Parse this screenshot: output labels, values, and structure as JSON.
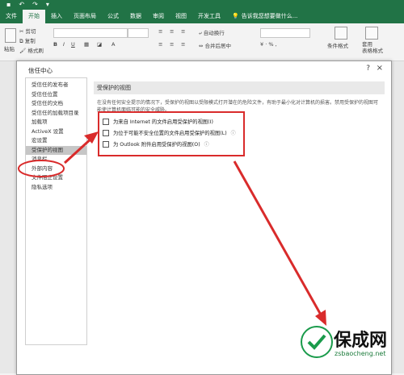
{
  "ribbon_tabs": [
    "文件",
    "开始",
    "插入",
    "页面布局",
    "公式",
    "数据",
    "审阅",
    "视图",
    "开发工具"
  ],
  "active_tab_index": 1,
  "tell_me": "告诉我您想要做什么...",
  "ribbon": {
    "paste": "粘贴",
    "cut": "剪切",
    "copy": "复制",
    "format_painter": "格式刷",
    "wrap_text": "自动换行",
    "merge_center": "合并后居中",
    "conditional_format": "条件格式",
    "table_style": "套用\n表格格式"
  },
  "dialog": {
    "title": "信任中心",
    "help": "?",
    "close": "×",
    "nav_items": [
      "受信任的发布者",
      "受信任位置",
      "受信任的文档",
      "受信任的加载项目录",
      "加载项",
      "ActiveX 设置",
      "宏设置",
      "受保护的视图",
      "消息栏",
      "外部内容",
      "文件阻止设置",
      "隐私选项"
    ],
    "active_nav_index": 7,
    "section_title": "受保护的视图",
    "description": "在没有任何安全提示的情况下，受保护的视图以受限模式打开潜在的危险文件，有助于最小化对计算机的损害。禁用受保护的视图可能使计算机面临可能的安全威胁。",
    "options": [
      {
        "label": "为来自 Internet 的文件启用受保护的视图(I)",
        "checked": false
      },
      {
        "label": "为位于可能不安全位置的文件启用受保护的视图(L)",
        "checked": false
      },
      {
        "label": "为 Outlook 附件启用受保护的视图(O)",
        "checked": false
      }
    ]
  },
  "watermark": {
    "brand": "保成网",
    "url": "zsbaocheng.net"
  },
  "colors": {
    "excel_green": "#217346",
    "annotation_red": "#d92b2b"
  }
}
